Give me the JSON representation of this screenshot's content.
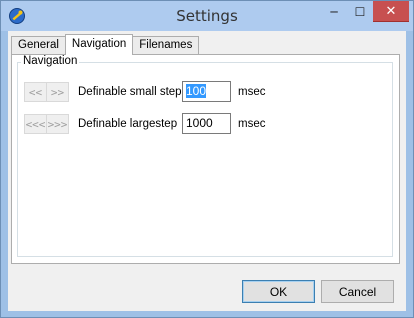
{
  "window": {
    "title": "Settings",
    "minimize_glyph": "─",
    "maximize_glyph": "☐",
    "close_glyph": "✕",
    "icon": "tool-icon"
  },
  "tabs": [
    {
      "label": "General",
      "active": false
    },
    {
      "label": "Navigation",
      "active": true
    },
    {
      "label": "Filenames",
      "active": false
    }
  ],
  "navigation": {
    "group_title": "Navigation",
    "small_step": {
      "back_label": "<<",
      "forward_label": ">>",
      "label": "Definable small step",
      "value_selected": "100",
      "value_rest": "",
      "unit": "msec"
    },
    "large_step": {
      "back_label": "<<<",
      "forward_label": ">>>",
      "label": "Definable largestep",
      "value": "1000",
      "unit": "msec"
    }
  },
  "buttons": {
    "ok": "OK",
    "cancel": "Cancel"
  },
  "colors": {
    "accent": "#3399ff",
    "close": "#c75050",
    "frame": "#9ec0e6"
  }
}
